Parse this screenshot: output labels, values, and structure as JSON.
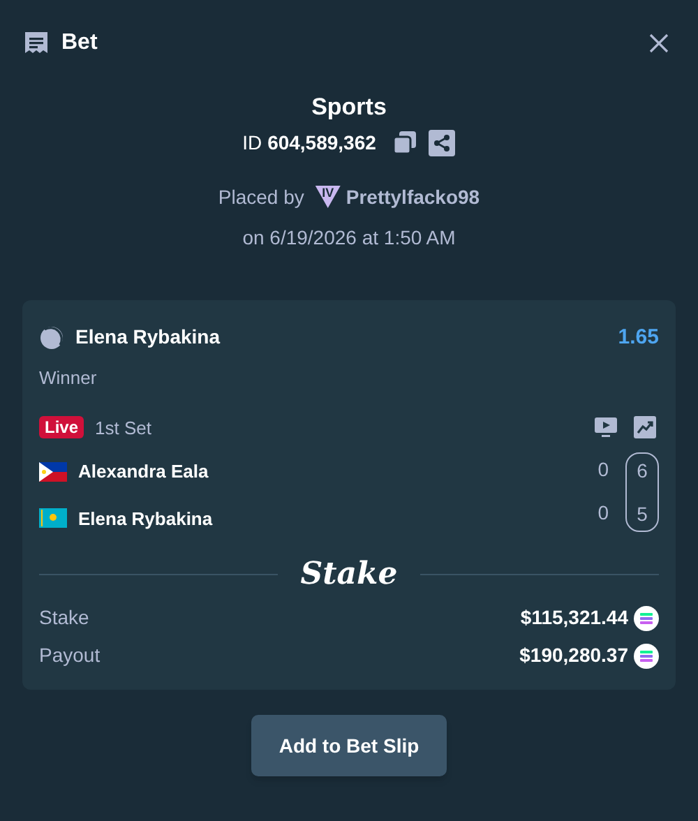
{
  "header": {
    "title": "Bet"
  },
  "bet": {
    "category": "Sports",
    "id_label": "ID",
    "id_value": "604,589,362",
    "placed_by": "Placed by",
    "vip_badge": "IV",
    "user": "Prettylfacko98",
    "date": "on 6/19/2026 at 1:50 AM"
  },
  "selection": {
    "name": "Elena Rybakina",
    "odds": "1.65",
    "market": "Winner",
    "live": true,
    "live_label": "Live",
    "period": "1st Set",
    "players": [
      {
        "name": "Alexandra Eala",
        "flag": {
          "kind": "ph"
        },
        "games": "0",
        "set": "6"
      },
      {
        "name": "Elena Rybakina",
        "flag": {
          "kind": "kz"
        },
        "games": "0",
        "set": "5"
      }
    ],
    "logo": "Stake",
    "amounts": [
      {
        "label": "Stake",
        "value": "$115,321.44"
      },
      {
        "label": "Payout",
        "value": "$190,280.37"
      }
    ]
  },
  "action": "Add to Bet Slip"
}
